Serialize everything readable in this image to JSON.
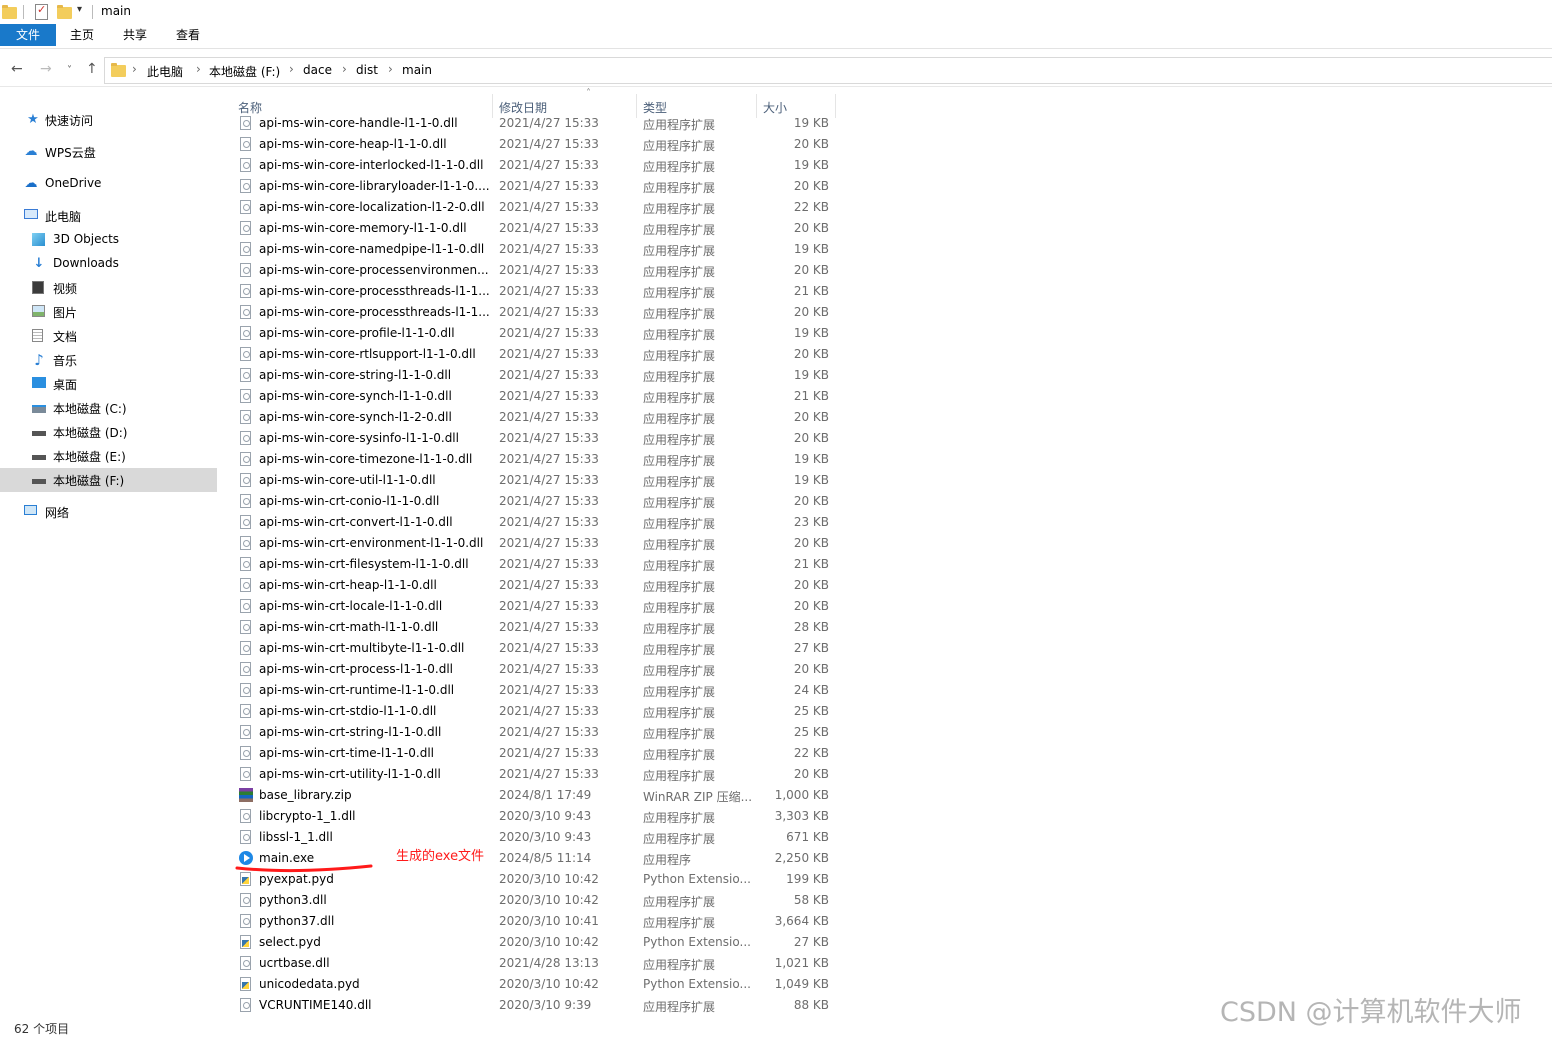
{
  "window": {
    "title": "main"
  },
  "ribbon": {
    "tabs": [
      "文件",
      "主页",
      "共享",
      "查看"
    ]
  },
  "address": {
    "path": [
      "此电脑",
      "本地磁盘 (F:)",
      "dace",
      "dist",
      "main"
    ]
  },
  "sidebar": {
    "items": [
      {
        "label": "快速访问",
        "icon": "star-icon"
      },
      {
        "label": "WPS云盘",
        "icon": "cloud-icon"
      },
      {
        "label": "OneDrive",
        "icon": "cloud-icon"
      },
      {
        "label": "此电脑",
        "icon": "computer-icon"
      },
      {
        "label": "3D Objects",
        "icon": "cube-icon"
      },
      {
        "label": "Downloads",
        "icon": "download-icon"
      },
      {
        "label": "视频",
        "icon": "video-icon"
      },
      {
        "label": "图片",
        "icon": "image-icon"
      },
      {
        "label": "文档",
        "icon": "document-icon"
      },
      {
        "label": "音乐",
        "icon": "music-icon"
      },
      {
        "label": "桌面",
        "icon": "desktop-icon"
      },
      {
        "label": "本地磁盘 (C:)",
        "icon": "drive-icon"
      },
      {
        "label": "本地磁盘 (D:)",
        "icon": "drive-icon"
      },
      {
        "label": "本地磁盘 (E:)",
        "icon": "drive-icon"
      },
      {
        "label": "本地磁盘 (F:)",
        "icon": "drive-icon",
        "selected": true
      },
      {
        "label": "网络",
        "icon": "network-icon"
      }
    ]
  },
  "columns": {
    "name": "名称",
    "date": "修改日期",
    "type": "类型",
    "size": "大小"
  },
  "files": [
    {
      "name": "api-ms-win-core-handle-l1-1-0.dll",
      "date": "2021/4/27 15:33",
      "type": "应用程序扩展",
      "size": "19 KB",
      "icon": "dll"
    },
    {
      "name": "api-ms-win-core-heap-l1-1-0.dll",
      "date": "2021/4/27 15:33",
      "type": "应用程序扩展",
      "size": "20 KB",
      "icon": "dll"
    },
    {
      "name": "api-ms-win-core-interlocked-l1-1-0.dll",
      "date": "2021/4/27 15:33",
      "type": "应用程序扩展",
      "size": "19 KB",
      "icon": "dll"
    },
    {
      "name": "api-ms-win-core-libraryloader-l1-1-0....",
      "date": "2021/4/27 15:33",
      "type": "应用程序扩展",
      "size": "20 KB",
      "icon": "dll"
    },
    {
      "name": "api-ms-win-core-localization-l1-2-0.dll",
      "date": "2021/4/27 15:33",
      "type": "应用程序扩展",
      "size": "22 KB",
      "icon": "dll"
    },
    {
      "name": "api-ms-win-core-memory-l1-1-0.dll",
      "date": "2021/4/27 15:33",
      "type": "应用程序扩展",
      "size": "20 KB",
      "icon": "dll"
    },
    {
      "name": "api-ms-win-core-namedpipe-l1-1-0.dll",
      "date": "2021/4/27 15:33",
      "type": "应用程序扩展",
      "size": "19 KB",
      "icon": "dll"
    },
    {
      "name": "api-ms-win-core-processenvironmen...",
      "date": "2021/4/27 15:33",
      "type": "应用程序扩展",
      "size": "20 KB",
      "icon": "dll"
    },
    {
      "name": "api-ms-win-core-processthreads-l1-1...",
      "date": "2021/4/27 15:33",
      "type": "应用程序扩展",
      "size": "21 KB",
      "icon": "dll"
    },
    {
      "name": "api-ms-win-core-processthreads-l1-1...",
      "date": "2021/4/27 15:33",
      "type": "应用程序扩展",
      "size": "20 KB",
      "icon": "dll"
    },
    {
      "name": "api-ms-win-core-profile-l1-1-0.dll",
      "date": "2021/4/27 15:33",
      "type": "应用程序扩展",
      "size": "19 KB",
      "icon": "dll"
    },
    {
      "name": "api-ms-win-core-rtlsupport-l1-1-0.dll",
      "date": "2021/4/27 15:33",
      "type": "应用程序扩展",
      "size": "20 KB",
      "icon": "dll"
    },
    {
      "name": "api-ms-win-core-string-l1-1-0.dll",
      "date": "2021/4/27 15:33",
      "type": "应用程序扩展",
      "size": "19 KB",
      "icon": "dll"
    },
    {
      "name": "api-ms-win-core-synch-l1-1-0.dll",
      "date": "2021/4/27 15:33",
      "type": "应用程序扩展",
      "size": "21 KB",
      "icon": "dll"
    },
    {
      "name": "api-ms-win-core-synch-l1-2-0.dll",
      "date": "2021/4/27 15:33",
      "type": "应用程序扩展",
      "size": "20 KB",
      "icon": "dll"
    },
    {
      "name": "api-ms-win-core-sysinfo-l1-1-0.dll",
      "date": "2021/4/27 15:33",
      "type": "应用程序扩展",
      "size": "20 KB",
      "icon": "dll"
    },
    {
      "name": "api-ms-win-core-timezone-l1-1-0.dll",
      "date": "2021/4/27 15:33",
      "type": "应用程序扩展",
      "size": "19 KB",
      "icon": "dll"
    },
    {
      "name": "api-ms-win-core-util-l1-1-0.dll",
      "date": "2021/4/27 15:33",
      "type": "应用程序扩展",
      "size": "19 KB",
      "icon": "dll"
    },
    {
      "name": "api-ms-win-crt-conio-l1-1-0.dll",
      "date": "2021/4/27 15:33",
      "type": "应用程序扩展",
      "size": "20 KB",
      "icon": "dll"
    },
    {
      "name": "api-ms-win-crt-convert-l1-1-0.dll",
      "date": "2021/4/27 15:33",
      "type": "应用程序扩展",
      "size": "23 KB",
      "icon": "dll"
    },
    {
      "name": "api-ms-win-crt-environment-l1-1-0.dll",
      "date": "2021/4/27 15:33",
      "type": "应用程序扩展",
      "size": "20 KB",
      "icon": "dll"
    },
    {
      "name": "api-ms-win-crt-filesystem-l1-1-0.dll",
      "date": "2021/4/27 15:33",
      "type": "应用程序扩展",
      "size": "21 KB",
      "icon": "dll"
    },
    {
      "name": "api-ms-win-crt-heap-l1-1-0.dll",
      "date": "2021/4/27 15:33",
      "type": "应用程序扩展",
      "size": "20 KB",
      "icon": "dll"
    },
    {
      "name": "api-ms-win-crt-locale-l1-1-0.dll",
      "date": "2021/4/27 15:33",
      "type": "应用程序扩展",
      "size": "20 KB",
      "icon": "dll"
    },
    {
      "name": "api-ms-win-crt-math-l1-1-0.dll",
      "date": "2021/4/27 15:33",
      "type": "应用程序扩展",
      "size": "28 KB",
      "icon": "dll"
    },
    {
      "name": "api-ms-win-crt-multibyte-l1-1-0.dll",
      "date": "2021/4/27 15:33",
      "type": "应用程序扩展",
      "size": "27 KB",
      "icon": "dll"
    },
    {
      "name": "api-ms-win-crt-process-l1-1-0.dll",
      "date": "2021/4/27 15:33",
      "type": "应用程序扩展",
      "size": "20 KB",
      "icon": "dll"
    },
    {
      "name": "api-ms-win-crt-runtime-l1-1-0.dll",
      "date": "2021/4/27 15:33",
      "type": "应用程序扩展",
      "size": "24 KB",
      "icon": "dll"
    },
    {
      "name": "api-ms-win-crt-stdio-l1-1-0.dll",
      "date": "2021/4/27 15:33",
      "type": "应用程序扩展",
      "size": "25 KB",
      "icon": "dll"
    },
    {
      "name": "api-ms-win-crt-string-l1-1-0.dll",
      "date": "2021/4/27 15:33",
      "type": "应用程序扩展",
      "size": "25 KB",
      "icon": "dll"
    },
    {
      "name": "api-ms-win-crt-time-l1-1-0.dll",
      "date": "2021/4/27 15:33",
      "type": "应用程序扩展",
      "size": "22 KB",
      "icon": "dll"
    },
    {
      "name": "api-ms-win-crt-utility-l1-1-0.dll",
      "date": "2021/4/27 15:33",
      "type": "应用程序扩展",
      "size": "20 KB",
      "icon": "dll"
    },
    {
      "name": "base_library.zip",
      "date": "2024/8/1 17:49",
      "type": "WinRAR ZIP 压缩...",
      "size": "1,000 KB",
      "icon": "zip"
    },
    {
      "name": "libcrypto-1_1.dll",
      "date": "2020/3/10 9:43",
      "type": "应用程序扩展",
      "size": "3,303 KB",
      "icon": "dll"
    },
    {
      "name": "libssl-1_1.dll",
      "date": "2020/3/10 9:43",
      "type": "应用程序扩展",
      "size": "671 KB",
      "icon": "dll"
    },
    {
      "name": "main.exe",
      "date": "2024/8/5 11:14",
      "type": "应用程序",
      "size": "2,250 KB",
      "icon": "exe"
    },
    {
      "name": "pyexpat.pyd",
      "date": "2020/3/10 10:42",
      "type": "Python Extensio...",
      "size": "199 KB",
      "icon": "pyd"
    },
    {
      "name": "python3.dll",
      "date": "2020/3/10 10:42",
      "type": "应用程序扩展",
      "size": "58 KB",
      "icon": "dll"
    },
    {
      "name": "python37.dll",
      "date": "2020/3/10 10:41",
      "type": "应用程序扩展",
      "size": "3,664 KB",
      "icon": "dll"
    },
    {
      "name": "select.pyd",
      "date": "2020/3/10 10:42",
      "type": "Python Extensio...",
      "size": "27 KB",
      "icon": "pyd"
    },
    {
      "name": "ucrtbase.dll",
      "date": "2021/4/28 13:13",
      "type": "应用程序扩展",
      "size": "1,021 KB",
      "icon": "dll"
    },
    {
      "name": "unicodedata.pyd",
      "date": "2020/3/10 10:42",
      "type": "Python Extensio...",
      "size": "1,049 KB",
      "icon": "pyd"
    },
    {
      "name": "VCRUNTIME140.dll",
      "date": "2020/3/10 9:39",
      "type": "应用程序扩展",
      "size": "88 KB",
      "icon": "dll"
    }
  ],
  "annotation": {
    "text": "生成的exe文件",
    "color": "#ff1a1a"
  },
  "status": {
    "item_count": "62 个项目"
  },
  "watermark": {
    "text": "CSDN @计算机软件大师"
  },
  "colors": {
    "file_tab": "#1979ca",
    "selected_nav": "#d9d9d9"
  }
}
